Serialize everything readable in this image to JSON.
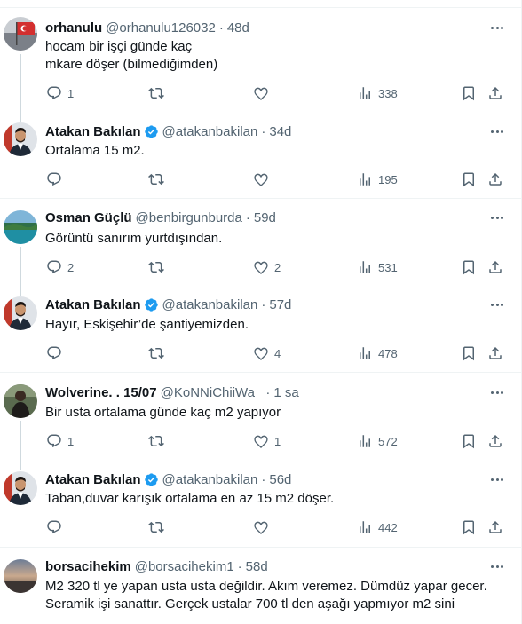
{
  "tweets": [
    {
      "name": "orhanulu",
      "handle": "@orhanulu126032",
      "time": "48d",
      "verified": false,
      "text": "hocam bir işçi günde kaç\nmkare döşer (bilmediğimden)",
      "replies": "1",
      "retweets": "",
      "likes": "",
      "views": "338",
      "avatar": "flag-profile"
    },
    {
      "name": "Atakan Bakılan",
      "handle": "@atakanbakilan",
      "time": "34d",
      "verified": true,
      "text": "Ortalama 15 m2.",
      "replies": "",
      "retweets": "",
      "likes": "",
      "views": "195",
      "avatar": "man-suit"
    },
    {
      "name": "Osman Güçlü",
      "handle": "@benbirgunburda",
      "time": "59d",
      "verified": false,
      "text": "Görüntü sanırım yurtdışından.",
      "replies": "2",
      "retweets": "",
      "likes": "2",
      "views": "531",
      "avatar": "coast"
    },
    {
      "name": "Atakan Bakılan",
      "handle": "@atakanbakilan",
      "time": "57d",
      "verified": true,
      "text": "Hayır, Eskişehir’de şantiyemizden.",
      "replies": "",
      "retweets": "",
      "likes": "4",
      "views": "478",
      "avatar": "man-suit"
    },
    {
      "name": "Wolverine. . 15/07",
      "handle": "@KoNNiChiiWa_",
      "time": "1 sa",
      "verified": false,
      "text": "Bir usta ortalama günde kaç m2 yapıyor",
      "replies": "1",
      "retweets": "",
      "likes": "1",
      "views": "572",
      "avatar": "dark-figure"
    },
    {
      "name": "Atakan Bakılan",
      "handle": "@atakanbakilan",
      "time": "56d",
      "verified": true,
      "text": "Taban,duvar karışık ortalama en az 15 m2 döşer.",
      "replies": "",
      "retweets": "",
      "likes": "",
      "views": "442",
      "avatar": "man-suit"
    },
    {
      "name": "borsacihekim",
      "handle": "@borsacihekim1",
      "time": "58d",
      "verified": false,
      "text": "M2 320 tl ye yapan usta usta değildir. Akım veremez. Dümdüz yapar gecer.\nSeramik işi sanattır. Gerçek ustalar 700 tl den aşağı yapmıyor m2 sini",
      "replies": "",
      "retweets": "",
      "likes": "",
      "views": "",
      "avatar": "sunset"
    }
  ],
  "icons": {
    "reply": "reply-icon",
    "retweet": "retweet-icon",
    "like": "heart-icon",
    "views": "views-icon",
    "bookmark": "bookmark-icon",
    "share": "share-icon",
    "more": "more-icon",
    "verified": "verified-badge-icon"
  },
  "colors": {
    "text": "#0f1419",
    "secondary": "#536471",
    "verified": "#1d9bf0",
    "border": "#eff3f4",
    "thread_line": "#cfd9de"
  }
}
